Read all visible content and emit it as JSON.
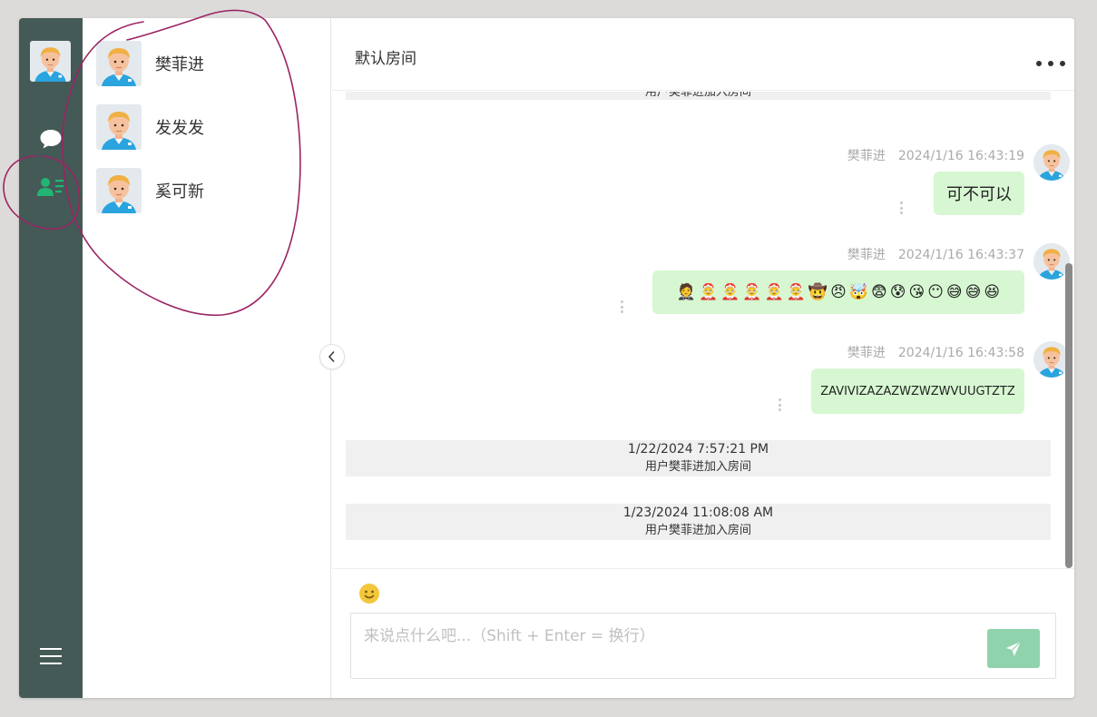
{
  "colors": {
    "rail_bg": "#445a56",
    "active_icon": "#22b573",
    "bubble_bg": "#d7f7d2",
    "send_button": "#8fd3ad",
    "annotation_ink": "#9b2463"
  },
  "rail": {
    "icons": [
      "user-avatar",
      "chat-bubble-icon",
      "contacts-icon",
      "hamburger-menu-icon"
    ]
  },
  "contacts": [
    {
      "name": "樊菲进"
    },
    {
      "name": "发发发"
    },
    {
      "name": "奚可新"
    }
  ],
  "chat": {
    "title": "默认房间",
    "partial_system_text": "用户樊菲进加入房间",
    "messages": [
      {
        "sender": "樊菲进",
        "time": "2024/1/16 16:43:19",
        "text": "可不可以"
      },
      {
        "sender": "樊菲进",
        "time": "2024/1/16 16:43:37",
        "emojis": [
          "🤵",
          "🤶",
          "🤶",
          "🤶",
          "🤶",
          "🤶",
          "🤠",
          "😠",
          "🤯",
          "😨",
          "😰",
          "😘",
          "😶",
          "😅",
          "😅",
          "😆"
        ]
      },
      {
        "sender": "樊菲进",
        "time": "2024/1/16 16:43:58",
        "text": "ZAVIVIZAZAZWZWZWVUUGTZTZ"
      }
    ],
    "system_events": [
      {
        "time": "1/22/2024 7:57:21 PM",
        "text": "用户樊菲进加入房间"
      },
      {
        "time": "1/23/2024 11:08:08 AM",
        "text": "用户樊菲进加入房间"
      }
    ]
  },
  "composer": {
    "placeholder": "来说点什么吧...（Shift + Enter = 换行）"
  }
}
